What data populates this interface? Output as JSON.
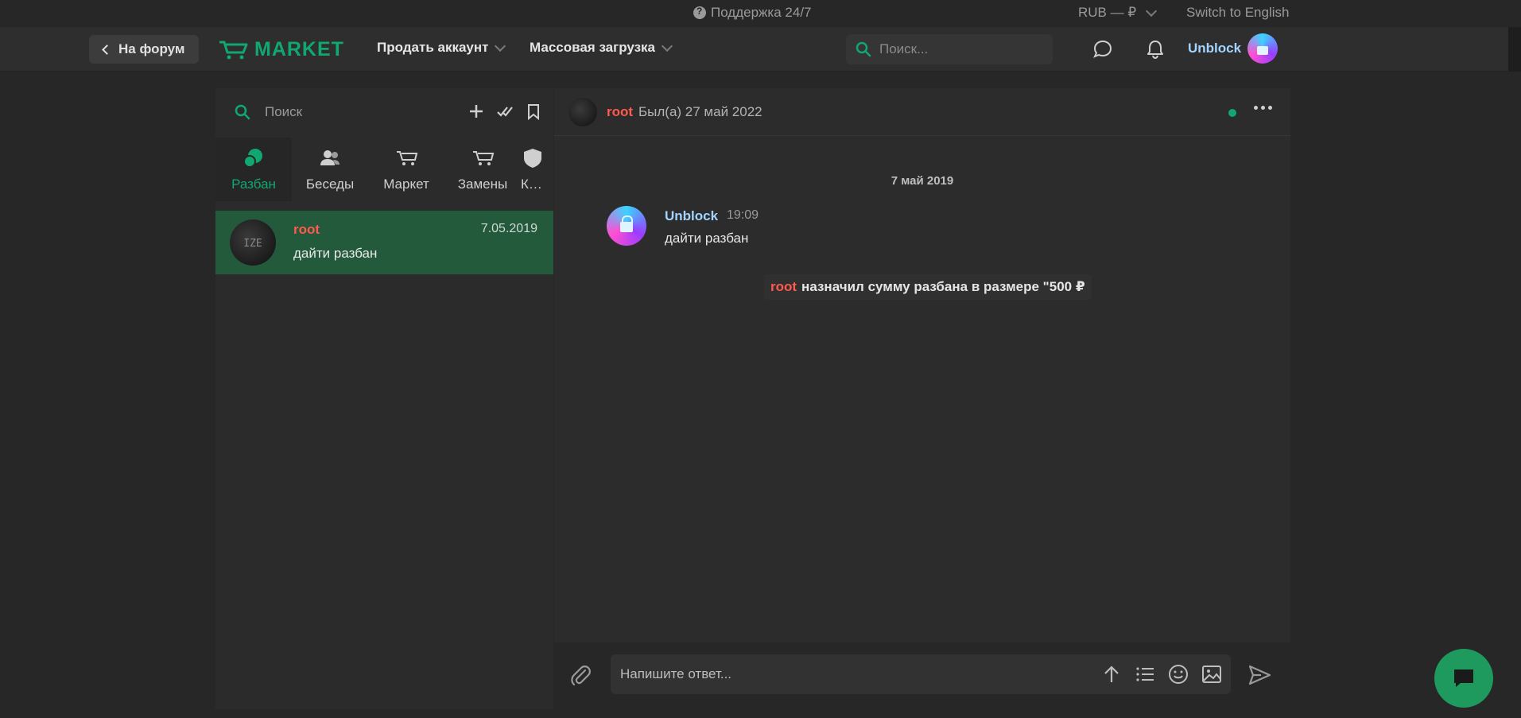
{
  "topbar": {
    "support": "Поддержка 24/7",
    "currency": "RUB — ₽",
    "language": "Switch to English"
  },
  "header": {
    "back": "На форум",
    "logo": "MARKET",
    "nav": [
      "Продать аккаунт",
      "Массовая загрузка"
    ],
    "search_placeholder": "Поиск...",
    "username": "Unblock"
  },
  "sidebar": {
    "search_placeholder": "Поиск",
    "tabs": [
      {
        "label": "Разбан",
        "icon": "chat-bubbles-icon",
        "active": true
      },
      {
        "label": "Беседы",
        "icon": "users-icon",
        "active": false
      },
      {
        "label": "Маркет",
        "icon": "cart-icon",
        "active": false
      },
      {
        "label": "Замены",
        "icon": "cart-icon",
        "active": false
      },
      {
        "label": "К…",
        "icon": "shield-icon",
        "active": false
      }
    ],
    "conversations": [
      {
        "name": "root",
        "date": "7.05.2019",
        "preview": "дайти разбан"
      }
    ]
  },
  "chat": {
    "header": {
      "name": "root",
      "status": "Был(а) 27 май 2022"
    },
    "day_separator": "7 май 2019",
    "messages": [
      {
        "author": "Unblock",
        "time": "19:09",
        "text": "дайти разбан"
      }
    ],
    "system": {
      "name": "root",
      "text": "назначил сумму разбана в размере \"500 ₽"
    },
    "composer_placeholder": "Напишите ответ..."
  },
  "colors": {
    "accent": "#11a771",
    "active_conversation": "#235a3c",
    "username_link": "#a3d4ff",
    "root_name": "#ff5a4f"
  }
}
